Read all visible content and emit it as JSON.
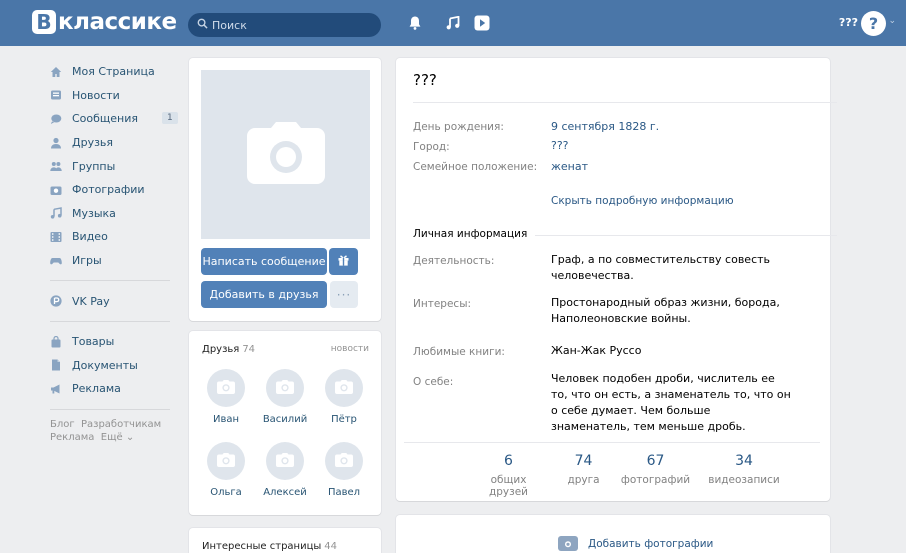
{
  "header": {
    "logo_letter": "В",
    "logo_text": "классике",
    "search_placeholder": "Поиск",
    "user_name": "???",
    "avatar_text": "?",
    "icons": [
      "bell-icon",
      "music-icon",
      "play-icon"
    ],
    "brand_color": "#4a76a8"
  },
  "sidebar": {
    "items": [
      {
        "label": "Моя Страница",
        "icon": "home-icon"
      },
      {
        "label": "Новости",
        "icon": "news-icon"
      },
      {
        "label": "Сообщения",
        "icon": "chat-icon",
        "badge": "1"
      },
      {
        "label": "Друзья",
        "icon": "user-icon"
      },
      {
        "label": "Группы",
        "icon": "group-icon"
      },
      {
        "label": "Фотографии",
        "icon": "camera-icon"
      },
      {
        "label": "Музыка",
        "icon": "music-icon"
      },
      {
        "label": "Видео",
        "icon": "video-icon"
      },
      {
        "label": "Игры",
        "icon": "gamepad-icon"
      }
    ],
    "vkpay": {
      "label": "VK Pay",
      "icon": "vkpay-icon"
    },
    "extra_items": [
      {
        "label": "Товары",
        "icon": "bag-icon"
      },
      {
        "label": "Документы",
        "icon": "document-icon"
      },
      {
        "label": "Реклама",
        "icon": "megaphone-icon"
      }
    ],
    "footer": {
      "blog": "Блог",
      "developers": "Разработчикам",
      "ads": "Реклама",
      "more": "Ещё"
    }
  },
  "profile": {
    "buttons": {
      "message": "Написать сообщение",
      "add_friend": "Добавить в друзья",
      "more": "···"
    },
    "friends": {
      "title": "Друзья",
      "count": "74",
      "news_link": "новости",
      "list": [
        "Иван",
        "Василий",
        "Пётр",
        "Ольга",
        "Алексей",
        "Павел"
      ]
    },
    "interesting": {
      "title": "Интересные страницы",
      "count": "44"
    }
  },
  "info": {
    "name": "???",
    "basic": [
      {
        "label": "День рождения:",
        "value": "9 сентября 1828 г."
      },
      {
        "label": "Город:",
        "value": "???"
      },
      {
        "label": "Семейное положение:",
        "value": "женат"
      }
    ],
    "hide_link": "Скрыть подробную информацию",
    "section_title": "Личная информация",
    "personal": [
      {
        "label": "Деятельность:",
        "value": "Граф, а по совместительству совесть человечества."
      },
      {
        "label": "Интересы:",
        "value": "Простонародный образ жизни, борода, Наполеоновские войны."
      },
      {
        "label": "Любимые книги:",
        "value": "Жан-Жак Руссо"
      },
      {
        "label": "О себе:",
        "value": "Человек подобен дроби, числитель ее то, что он есть, а знаменатель то, что он о себе думает. Чем больше знаменатель, тем меньше дробь."
      }
    ],
    "stats": [
      {
        "num": "6",
        "label": "общих друзей"
      },
      {
        "num": "74",
        "label": "друга"
      },
      {
        "num": "67",
        "label": "фотографий"
      },
      {
        "num": "34",
        "label": "видеозаписи"
      }
    ]
  },
  "photos": {
    "add_label": "Добавить фотографии"
  }
}
